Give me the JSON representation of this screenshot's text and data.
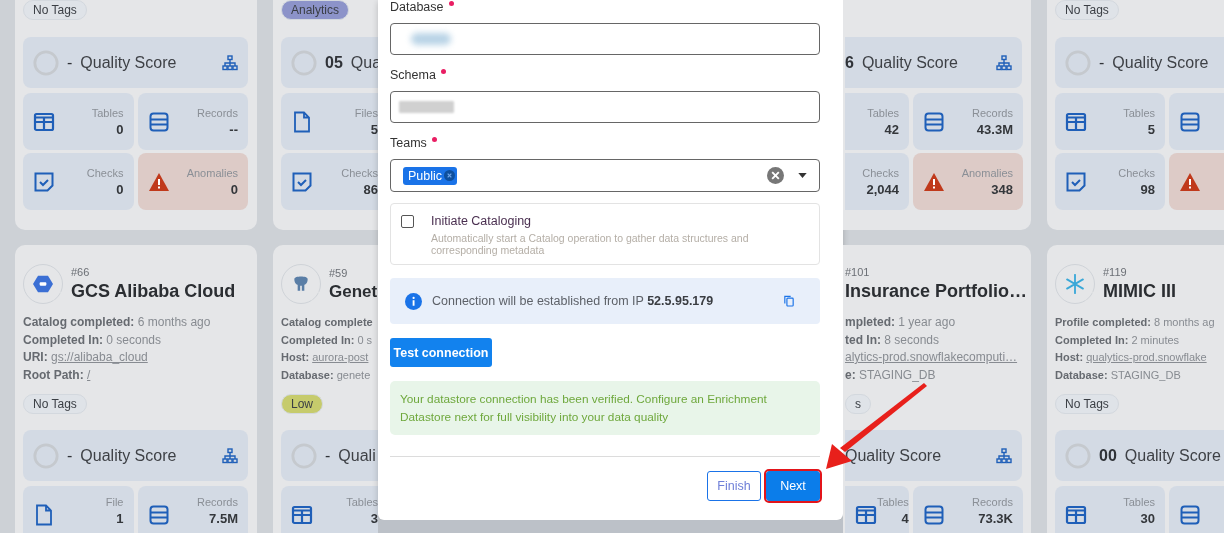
{
  "columns": [
    {
      "top": {
        "tag": {
          "label": "No Tags",
          "color": "#dfe3e8"
        },
        "quality": {
          "score": "-",
          "label": "Quality Score",
          "tree_icon": true
        },
        "stats": [
          {
            "kind": "tables",
            "label": "Tables",
            "value": "0"
          },
          {
            "kind": "records",
            "label": "Records",
            "value": "--"
          },
          {
            "kind": "checks",
            "label": "Checks",
            "value": "0"
          },
          {
            "kind": "anomalies",
            "label": "Anomalies",
            "value": "0"
          }
        ]
      },
      "bottom": {
        "id": "#66",
        "name": "GCS Alibaba Cloud",
        "logo": {
          "kind": "gcs"
        },
        "online": true,
        "details": [
          {
            "label": "Catalog completed:",
            "value": "6 months ago",
            "link": false
          },
          {
            "label": "Completed In:",
            "value": "0 seconds",
            "link": false
          },
          {
            "label": "URI:",
            "value": "gs://alibaba_cloud",
            "link": true
          },
          {
            "label": "Root Path:",
            "value": "/",
            "link": true
          }
        ],
        "tag": {
          "label": "No Tags",
          "color": "#dfe3e8"
        },
        "quality": {
          "score": "-",
          "label": "Quality Score",
          "tree_icon": true
        },
        "stats": [
          {
            "kind": "files",
            "label": "File",
            "value": "1"
          },
          {
            "kind": "records",
            "label": "Records",
            "value": "7.5M"
          }
        ]
      }
    },
    {
      "top": {
        "tag": {
          "label": "Analytics",
          "color": "#8c93c9"
        },
        "quality": {
          "score": "05",
          "label": "Qua",
          "tree_icon": false
        },
        "stats": [
          {
            "kind": "files",
            "label": "Files",
            "value": "5"
          },
          {
            "kind": "checks",
            "label": "Checks",
            "value": "86"
          }
        ]
      },
      "bottom": {
        "id": "#59",
        "name": "Genet",
        "logo": {
          "kind": "postgres"
        },
        "online": true,
        "details": [
          {
            "label": "Catalog complete",
            "link": false
          },
          {
            "label": "Completed In:",
            "value": "0 s",
            "link": false
          },
          {
            "label": "Host:",
            "value": "aurora-post",
            "link": true
          },
          {
            "label": "Database:",
            "value": "genete",
            "link": false
          }
        ],
        "tag": {
          "label": "Low",
          "color": "#c6cb6c"
        },
        "quality": {
          "score": "-",
          "label": "Quali",
          "tree_icon": false
        },
        "stats": [
          {
            "kind": "tables",
            "label": "Tables",
            "value": "3"
          }
        ]
      }
    },
    {
      "top": {
        "quality": {
          "score": "6",
          "label": "Quality Score",
          "tree_icon": true
        },
        "stats": [
          {
            "kind": "tables",
            "label": "Tables",
            "value": "42"
          },
          {
            "kind": "records",
            "label": "Records",
            "value": "43.3M"
          },
          {
            "kind": "checks",
            "label": "Checks",
            "value": "2,044"
          },
          {
            "kind": "anomalies",
            "label": "Anomalies",
            "value": "348"
          }
        ]
      },
      "bottom": {
        "id": "#101",
        "name": "Insurance Portfolio…",
        "details": [
          {
            "label": "mpleted:",
            "value": "1 year ago",
            "link": false
          },
          {
            "label": "ted In:",
            "value": "8 seconds",
            "link": false
          },
          {
            "value": "alytics-prod.snowflakecomputi…",
            "link": true
          },
          {
            "label": "e:",
            "value": "STAGING_DB",
            "link": false
          }
        ],
        "tag": {
          "label": "s",
          "color": "#dfe3e8"
        },
        "quality": {
          "label": "Quality Score",
          "tree_icon": true
        },
        "stats": [
          {
            "kind": "tables",
            "label": "Tables",
            "value": "4"
          },
          {
            "kind": "records",
            "label": "Records",
            "value": "73.3K"
          }
        ]
      }
    },
    {
      "top": {
        "tag": {
          "label": "No Tags",
          "color": "#dfe3e8"
        },
        "quality": {
          "score": "-",
          "label": "Quality Score",
          "tree_icon": false
        },
        "stats": [
          {
            "kind": "tables",
            "label": "Tables",
            "value": "5"
          },
          {
            "kind": "records"
          },
          {
            "kind": "checks",
            "label": "Checks",
            "value": "98"
          },
          {
            "kind": "anomalies"
          }
        ]
      },
      "bottom": {
        "id": "#119",
        "name": "MIMIC III",
        "logo": {
          "kind": "snowflake"
        },
        "online": true,
        "details": [
          {
            "label": "Profile completed:",
            "value": "8 months ag",
            "link": false
          },
          {
            "label": "Completed In:",
            "value": "2 minutes",
            "link": false
          },
          {
            "label": "Host:",
            "value": "qualytics-prod.snowflake",
            "link": true
          },
          {
            "label": "Database:",
            "value": "STAGING_DB",
            "link": false
          }
        ],
        "tag": {
          "label": "No Tags",
          "color": "#dfe3e8"
        },
        "quality": {
          "score": "00",
          "label": "Quality Score",
          "tree_icon": false
        },
        "stats": [
          {
            "kind": "tables",
            "label": "Tables",
            "value": "30"
          },
          {
            "kind": "records"
          }
        ]
      }
    }
  ],
  "modal": {
    "fields": [
      {
        "label": "Database",
        "required": true,
        "kind": "text",
        "value_blurred": true
      },
      {
        "label": "Schema",
        "required": true,
        "kind": "text",
        "value_blurred": true
      },
      {
        "label": "Teams",
        "required": true,
        "kind": "multiselect",
        "chips": [
          "Public"
        ]
      }
    ],
    "cataloging": {
      "title": "Initiate Cataloging",
      "description": "Automatically start a Catalog operation to gather data structures and corresponding metadata",
      "checked": false
    },
    "info": "Connection will be established from IP **52.5.95.179**",
    "test_button": "Test connection",
    "success": "Your datastore connection has been verified. Configure an Enrichment Datastore next for full visibility into your data quality",
    "buttons": [
      {
        "label": "Finish",
        "kind": "outline",
        "highlighted": false
      },
      {
        "label": "Next",
        "kind": "primary",
        "highlighted": true
      }
    ]
  }
}
